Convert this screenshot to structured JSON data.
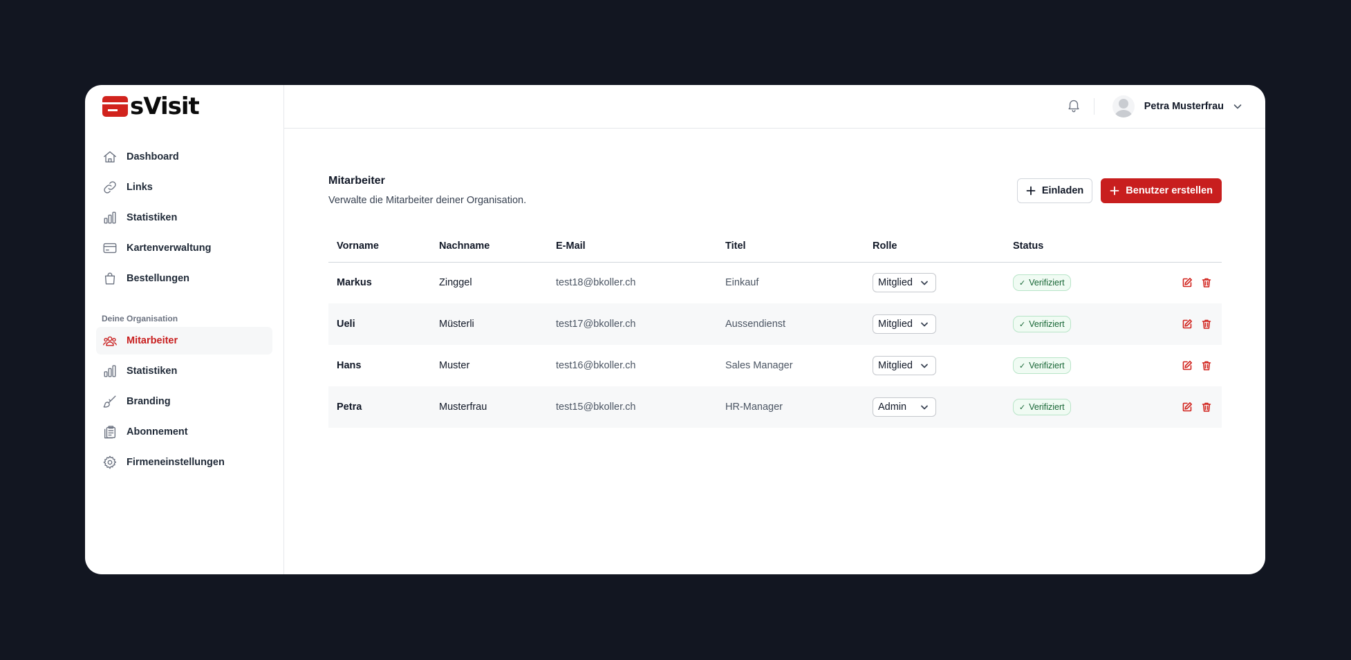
{
  "brand": {
    "name": "sVisit",
    "accent": "#c81e1e"
  },
  "sidebar": {
    "items": [
      {
        "label": "Dashboard",
        "icon": "home-icon"
      },
      {
        "label": "Links",
        "icon": "link-icon"
      },
      {
        "label": "Statistiken",
        "icon": "bar-chart-icon"
      },
      {
        "label": "Kartenverwaltung",
        "icon": "credit-card-icon"
      },
      {
        "label": "Bestellungen",
        "icon": "shopping-bag-icon"
      }
    ],
    "org_section_title": "Deine Organisation",
    "org_items": [
      {
        "label": "Mitarbeiter",
        "icon": "users-icon",
        "active": true
      },
      {
        "label": "Statistiken",
        "icon": "bar-chart-icon"
      },
      {
        "label": "Branding",
        "icon": "brush-icon"
      },
      {
        "label": "Abonnement",
        "icon": "clipboard-icon"
      },
      {
        "label": "Firmeneinstellungen",
        "icon": "gear-icon"
      }
    ]
  },
  "header": {
    "user_name": "Petra Musterfrau",
    "notification_icon": "bell-icon"
  },
  "page": {
    "title": "Mitarbeiter",
    "subtitle": "Verwalte die Mitarbeiter deiner Organisation.",
    "invite_label": "Einladen",
    "create_label": "Benutzer erstellen"
  },
  "table": {
    "columns": [
      "Vorname",
      "Nachname",
      "E-Mail",
      "Titel",
      "Rolle",
      "Status"
    ],
    "rows": [
      {
        "vorname": "Markus",
        "nachname": "Zinggel",
        "email": "test18@bkoller.ch",
        "titel": "Einkauf",
        "rolle": "Mitglied",
        "status": "Verifiziert"
      },
      {
        "vorname": "Ueli",
        "nachname": "Müsterli",
        "email": "test17@bkoller.ch",
        "titel": "Aussendienst",
        "rolle": "Mitglied",
        "status": "Verifiziert"
      },
      {
        "vorname": "Hans",
        "nachname": "Muster",
        "email": "test16@bkoller.ch",
        "titel": "Sales Manager",
        "rolle": "Mitglied",
        "status": "Verifiziert"
      },
      {
        "vorname": "Petra",
        "nachname": "Musterfrau",
        "email": "test15@bkoller.ch",
        "titel": "HR-Manager",
        "rolle": "Admin",
        "status": "Verifiziert"
      }
    ]
  }
}
